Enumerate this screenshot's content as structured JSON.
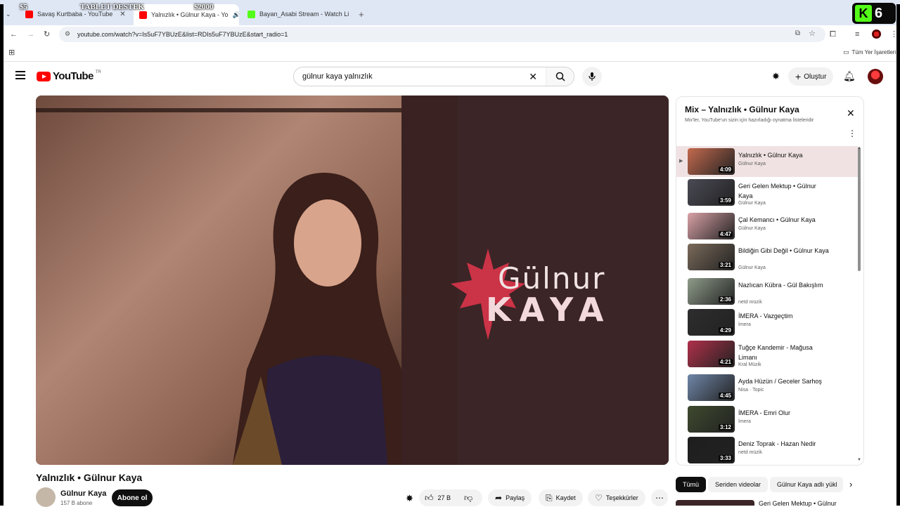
{
  "browser": {
    "tabs": [
      {
        "title": "Savaş Kurtbaba - YouTube",
        "fav_color": "#ff0000"
      },
      {
        "title": "Yalnızlık • Gülnur Kaya - Yo",
        "fav_color": "#ff0000"
      },
      {
        "title": "Bayan_Asabi Stream - Watch Li",
        "fav_color": "#53fc18"
      }
    ],
    "url": "youtube.com/watch?v=Is5uF7YBUzE&list=RDIs5uF7YBUzE&start_radio=1",
    "bookmarks_label": "Tüm Yer İşaretleri"
  },
  "stream_overlay": {
    "label_1": "$5",
    "label_2": "TABLET DESTEK",
    "label_3": "$2000",
    "badge_letter": "K",
    "badge_count": "6"
  },
  "youtube": {
    "logo_text": "YouTube",
    "logo_country": "TR",
    "search_value": "gülnur kaya yalnızlık",
    "create_label": "Oluştur"
  },
  "video": {
    "title": "Yalnızlık • Gülnur Kaya",
    "brand_line1": "Gülnur",
    "brand_line2": "KAYA",
    "channel_name": "Gülnur Kaya",
    "channel_subs": "157 B abone",
    "subscribe_label": "Abone ol",
    "like_count": "27 B",
    "share_label": "Paylaş",
    "save_label": "Kaydet",
    "thanks_label": "Teşekkürler"
  },
  "playlist": {
    "title": "Mix – Yalnızlık • Gülnur Kaya",
    "subtitle": "Mix'ler, YouTube'un sizin için hazırladığı oynatma listeleridir",
    "items": [
      {
        "title": "Yalnızlık • Gülnur Kaya",
        "channel": "Gülnur Kaya",
        "duration": "4:09",
        "thumb": "#c46a4e",
        "active": true
      },
      {
        "title": "Geri Gelen Mektup • Gülnur Kaya",
        "channel": "Gülnur Kaya",
        "duration": "3:59",
        "thumb": "#4a4a55"
      },
      {
        "title": "Çal Kemancı • Gülnur Kaya",
        "channel": "Gülnur Kaya",
        "duration": "4:47",
        "thumb": "#d9a1a6"
      },
      {
        "title": "Bildiğin Gibi Değil • Gülnur Kaya",
        "channel": "Gülnur Kaya",
        "duration": "3:21",
        "thumb": "#7a6a5a"
      },
      {
        "title": "Nazlıcan Kübra - Gül Bakışlım",
        "channel": "netd müzik",
        "duration": "2:36",
        "thumb": "#8f9c8a"
      },
      {
        "title": "İMERA - Vazgeçtim",
        "channel": "İmera",
        "duration": "4:29",
        "thumb": "#2d2d2d"
      },
      {
        "title": "Tuğçe Kandemir - Mağusa Limanı",
        "channel": "Kral Müzik",
        "duration": "4:21",
        "thumb": "#b0304a"
      },
      {
        "title": "Ayda Hüzün / Geceler Sarhoş",
        "channel": "Nisa · Topic",
        "duration": "4:45",
        "thumb": "#6f86a8"
      },
      {
        "title": "İMERA - Emri Olur",
        "channel": "İmera",
        "duration": "3:12",
        "thumb": "#3e4a2e"
      },
      {
        "title": "Deniz Toprak - Hazan Nedir",
        "channel": "netd müzik",
        "duration": "3:33",
        "thumb": "#1e1e1e"
      }
    ]
  },
  "chips": {
    "all": "Tümü",
    "series": "Seriden videolar",
    "from_channel": "Gülnur Kaya adlı yükl"
  },
  "next_video_title": "Geri Gelen Mektup • Gülnur"
}
